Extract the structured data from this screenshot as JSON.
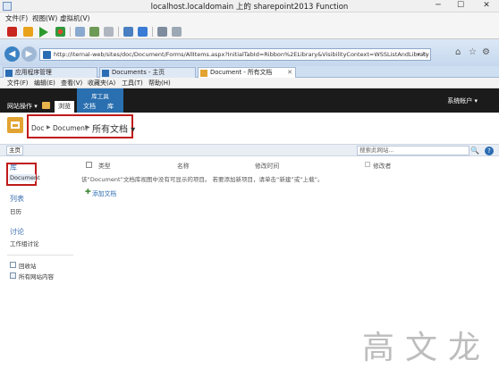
{
  "vm_window": {
    "title": "localhost.localdomain 上的 sharepoint2013 Function",
    "menu": [
      "文件(F)",
      "视图(W)",
      "虚拟机(V)"
    ]
  },
  "browser": {
    "url": "http://iternal-web/sites/doc/Document/Forms/AllItems.aspx?InitialTabId=Ribbon%2ELibrary&VisibilityContext=WSSListAndLibrary",
    "tabs": [
      {
        "label": "应用程序管理",
        "active": false
      },
      {
        "label": "Documents - 主页",
        "active": false
      },
      {
        "label": "Document - 所有文档",
        "active": true
      }
    ],
    "menu": [
      "文件(F)",
      "编辑(E)",
      "查看(V)",
      "收藏夹(A)",
      "工具(T)",
      "帮助(H)"
    ]
  },
  "ribbon": {
    "site_actions": "网站操作 ▾",
    "browse_tab": "浏览",
    "context_group": "库工具",
    "documents_tab": "文档",
    "library_tab": "库",
    "account": "系统帐户 ▾"
  },
  "breadcrumb": {
    "site": "Doc",
    "library": "Document",
    "view": "所有文档 ▾"
  },
  "topnav": {
    "home": "主页",
    "search_placeholder": "搜索此网站..."
  },
  "quick_launch": {
    "libraries_heading": "库",
    "library_item": "Document",
    "lists_heading": "列表",
    "calendar": "日历",
    "discussions_heading": "讨论",
    "team_discussion": "工作组讨论",
    "recycle_bin": "回收站",
    "all_site_content": "所有网站内容"
  },
  "list_view": {
    "columns": [
      "类型",
      "名称",
      "修改时间",
      "修改者"
    ],
    "empty_message": "该“Document”文档库视图中没有可显示的项目。 若要添加新项目，请单击“新建”或“上载”。",
    "add_document": "添加文档"
  },
  "watermark": "高文龙"
}
